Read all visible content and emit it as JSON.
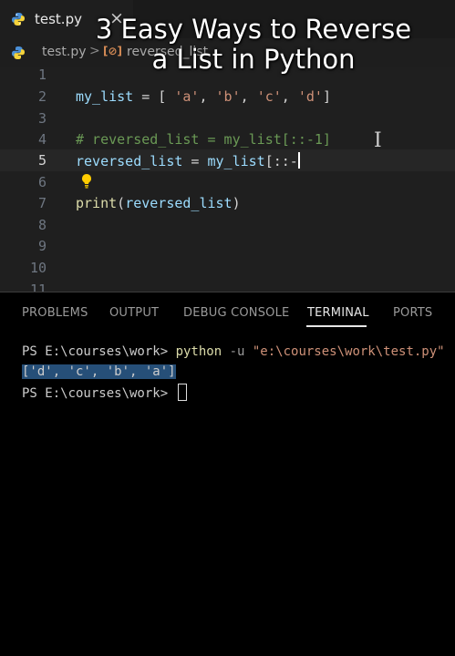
{
  "title_overlay": {
    "line1": "3 Easy Ways to Reverse",
    "line2": "a List in Python"
  },
  "tab": {
    "filename": "test.py",
    "close": "×"
  },
  "breadcrumb": {
    "file": "test.py",
    "separator": ">",
    "symbol_icon": "[⊘]",
    "symbol": "reversed_list"
  },
  "editor": {
    "line_numbers": [
      "1",
      "2",
      "3",
      "4",
      "5",
      "6",
      "7",
      "8",
      "9",
      "10",
      "11"
    ],
    "active_line": "5",
    "code": {
      "l2": {
        "a": "my_list",
        "b": " = [ ",
        "c": "'a'",
        "d": ", ",
        "e": "'b'",
        "f": ", ",
        "g": "'c'",
        "h": ", ",
        "i": "'d'",
        "j": "]"
      },
      "l4": "# reversed_list = my_list[::-1]",
      "l5": {
        "a": "reversed_list",
        "b": " = ",
        "c": "my_list",
        "d": "[::-"
      },
      "l7": {
        "a": "print",
        "b": "(",
        "c": "reversed_list",
        "d": ")"
      }
    }
  },
  "panel": {
    "tabs": [
      "PROBLEMS",
      "OUTPUT",
      "DEBUG CONSOLE",
      "TERMINAL",
      "PORTS"
    ],
    "active_tab": "TERMINAL"
  },
  "terminal": {
    "prompt": "PS E:\\courses\\work> ",
    "command": "python",
    "option": " -u ",
    "path_arg": "\"e:\\courses\\work\\test.py\"",
    "output": "['d', 'c', 'b', 'a']",
    "prompt2": "PS E:\\courses\\work> "
  },
  "colors": {
    "editor_bg": "#1f1f1f",
    "terminal_bg": "#000000",
    "string": "#ce9178",
    "variable": "#9cdcfe",
    "function": "#dcdcaa",
    "comment": "#6a9955"
  },
  "icons": [
    "python-file-icon",
    "close-icon",
    "symbol-variable-icon",
    "lightbulb-icon",
    "text-cursor-icon"
  ]
}
